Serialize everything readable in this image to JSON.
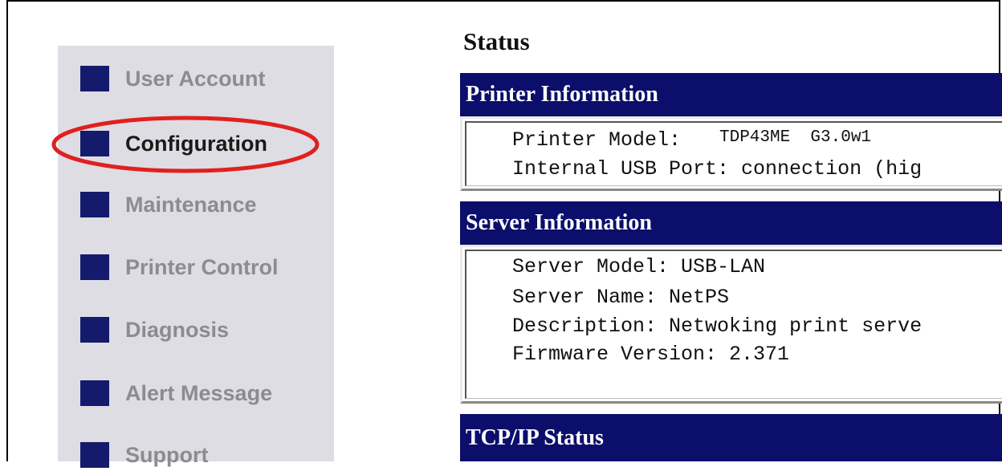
{
  "sidebar": {
    "items": [
      {
        "label": "User Account"
      },
      {
        "label": "Configuration"
      },
      {
        "label": "Maintenance"
      },
      {
        "label": "Printer Control"
      },
      {
        "label": "Diagnosis"
      },
      {
        "label": "Alert Message"
      },
      {
        "label": "Support"
      }
    ],
    "active_item": "Configuration"
  },
  "main": {
    "title": "Status",
    "printer_info": {
      "header": "Printer Information",
      "model_label": "Printer Model:",
      "model_value": "TDP43ME  G3.0w1",
      "usb_line": "Internal USB Port: connection (hig"
    },
    "server_info": {
      "header": "Server Information",
      "lines": [
        "Server Model: USB-LAN",
        "Server Name: NetPS",
        "Description: Netwoking print serve",
        "Firmware Version: 2.371"
      ]
    },
    "tcpip": {
      "header": "TCP/IP Status"
    }
  },
  "colors": {
    "nav_square": "#141a6c",
    "header_bg": "#0b0e6a",
    "sidebar_bg": "#dedde3",
    "highlight": "#e02020"
  }
}
